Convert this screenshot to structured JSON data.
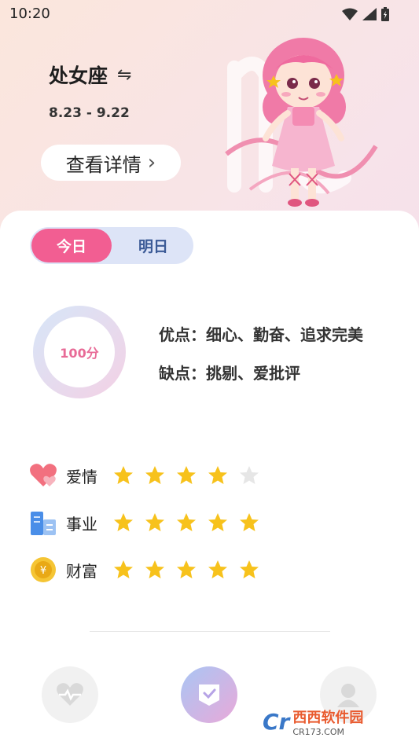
{
  "status_bar": {
    "time": "10:20"
  },
  "header": {
    "sign_name": "处女座",
    "date_range": "8.23 - 9.22",
    "detail_button": "查看详情"
  },
  "day_tabs": [
    {
      "label": "今日",
      "active": true
    },
    {
      "label": "明日",
      "active": false
    }
  ],
  "score": {
    "text": "100分",
    "value": 100
  },
  "traits": {
    "pros": "优点：细心、勤奋、追求完美",
    "cons": "缺点：挑剔、爱批评"
  },
  "ratings": [
    {
      "label": "爱情",
      "icon": "heart-icon",
      "stars": 4,
      "max": 5
    },
    {
      "label": "事业",
      "icon": "building-icon",
      "stars": 5,
      "max": 5
    },
    {
      "label": "财富",
      "icon": "coin-icon",
      "stars": 5,
      "max": 5
    }
  ],
  "bottom_nav": [
    {
      "icon": "heartbeat-icon",
      "active": false
    },
    {
      "icon": "check-card-icon",
      "active": true
    },
    {
      "icon": "profile-icon",
      "active": false
    }
  ],
  "watermark": {
    "brand": "西西软件园",
    "url": "CR173.COM"
  },
  "colors": {
    "accent": "#f25e92",
    "tab_inactive_bg": "#dde4f7",
    "star": "#f7c21c"
  }
}
